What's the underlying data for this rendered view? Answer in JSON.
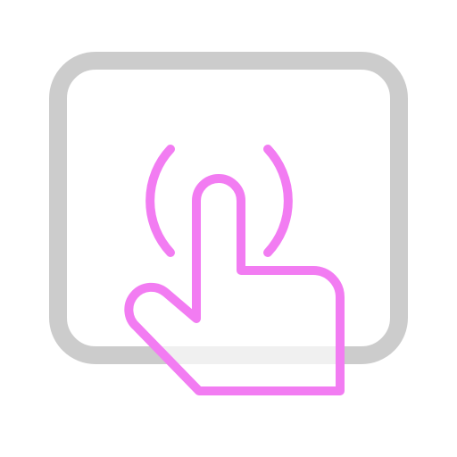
{
  "icon": {
    "name": "tap-gesture-icon",
    "parts": [
      "touch-panel-frame",
      "press-signal-waves",
      "pointing-hand"
    ]
  },
  "colors": {
    "frame": "#cccccc",
    "hand": "#f27cf2",
    "waves": "#f27cf2",
    "fill": "#ffffff",
    "background": "#ffffff"
  }
}
